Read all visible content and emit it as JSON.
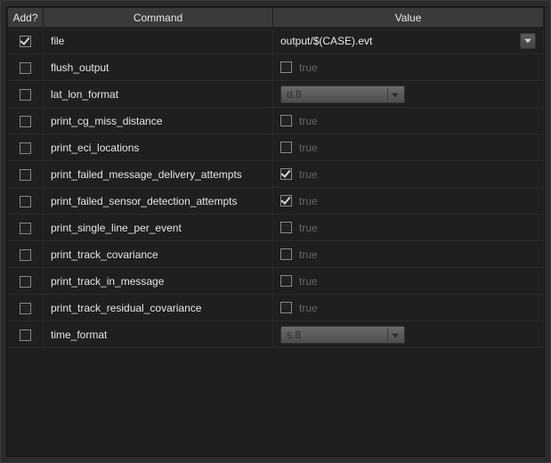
{
  "headers": {
    "add": "Add?",
    "command": "Command",
    "value": "Value"
  },
  "true_label": "true",
  "rows": [
    {
      "add_checked": true,
      "command": "file",
      "value_type": "textcombo",
      "text": "output/$(CASE).evt"
    },
    {
      "add_checked": false,
      "command": "flush_output",
      "value_type": "bool",
      "bool_checked": false
    },
    {
      "add_checked": false,
      "command": "lat_lon_format",
      "value_type": "combo",
      "combo": "d.8"
    },
    {
      "add_checked": false,
      "command": "print_cg_miss_distance",
      "value_type": "bool",
      "bool_checked": false
    },
    {
      "add_checked": false,
      "command": "print_eci_locations",
      "value_type": "bool",
      "bool_checked": false
    },
    {
      "add_checked": false,
      "command": "print_failed_message_delivery_attempts",
      "value_type": "bool",
      "bool_checked": true
    },
    {
      "add_checked": false,
      "command": "print_failed_sensor_detection_attempts",
      "value_type": "bool",
      "bool_checked": true
    },
    {
      "add_checked": false,
      "command": "print_single_line_per_event",
      "value_type": "bool",
      "bool_checked": false
    },
    {
      "add_checked": false,
      "command": "print_track_covariance",
      "value_type": "bool",
      "bool_checked": false
    },
    {
      "add_checked": false,
      "command": "print_track_in_message",
      "value_type": "bool",
      "bool_checked": false
    },
    {
      "add_checked": false,
      "command": "print_track_residual_covariance",
      "value_type": "bool",
      "bool_checked": false
    },
    {
      "add_checked": false,
      "command": "time_format",
      "value_type": "combo",
      "combo": "s.8"
    }
  ]
}
